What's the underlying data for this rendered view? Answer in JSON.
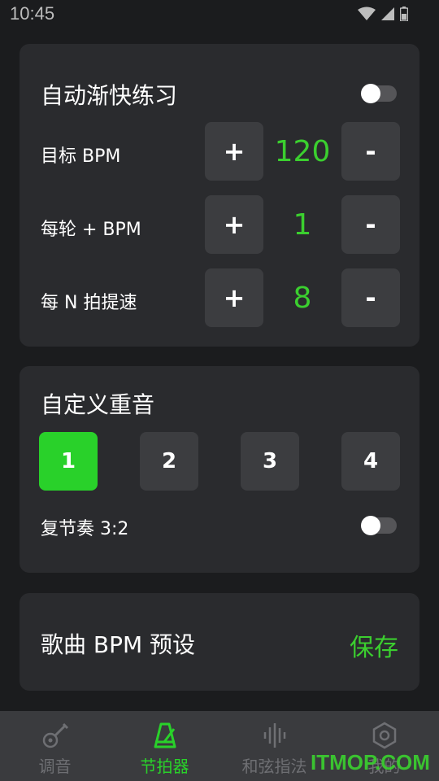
{
  "status": {
    "time": "10:45"
  },
  "auto_speedup": {
    "title": "自动渐快练习",
    "toggle_on": false,
    "rows": [
      {
        "label": "目标 BPM",
        "value": "120",
        "plus": "+",
        "minus": "-"
      },
      {
        "label": "每轮 + BPM",
        "value": "1",
        "plus": "+",
        "minus": "-"
      },
      {
        "label": "每 N 拍提速",
        "value": "8",
        "plus": "+",
        "minus": "-"
      }
    ]
  },
  "accent": {
    "title": "自定义重音",
    "beats": [
      "1",
      "2",
      "3",
      "4"
    ],
    "active_beat": "1",
    "polyrhythm_label": "复节奏 3:2",
    "polyrhythm_on": false
  },
  "preset": {
    "title": "歌曲 BPM 预设",
    "save_label": "保存"
  },
  "tabs": [
    {
      "label": "调音",
      "icon": "guitar-icon",
      "active": false
    },
    {
      "label": "节拍器",
      "icon": "metronome-icon",
      "active": true
    },
    {
      "label": "和弦指法",
      "icon": "sound-wave-icon",
      "active": false
    },
    {
      "label": "我的",
      "icon": "hexagon-icon",
      "active": false
    }
  ],
  "watermark": "ITMOP.COM",
  "colors": {
    "accent": "#29d12a",
    "card": "#2a2b2e",
    "background": "#1b1c1e"
  }
}
